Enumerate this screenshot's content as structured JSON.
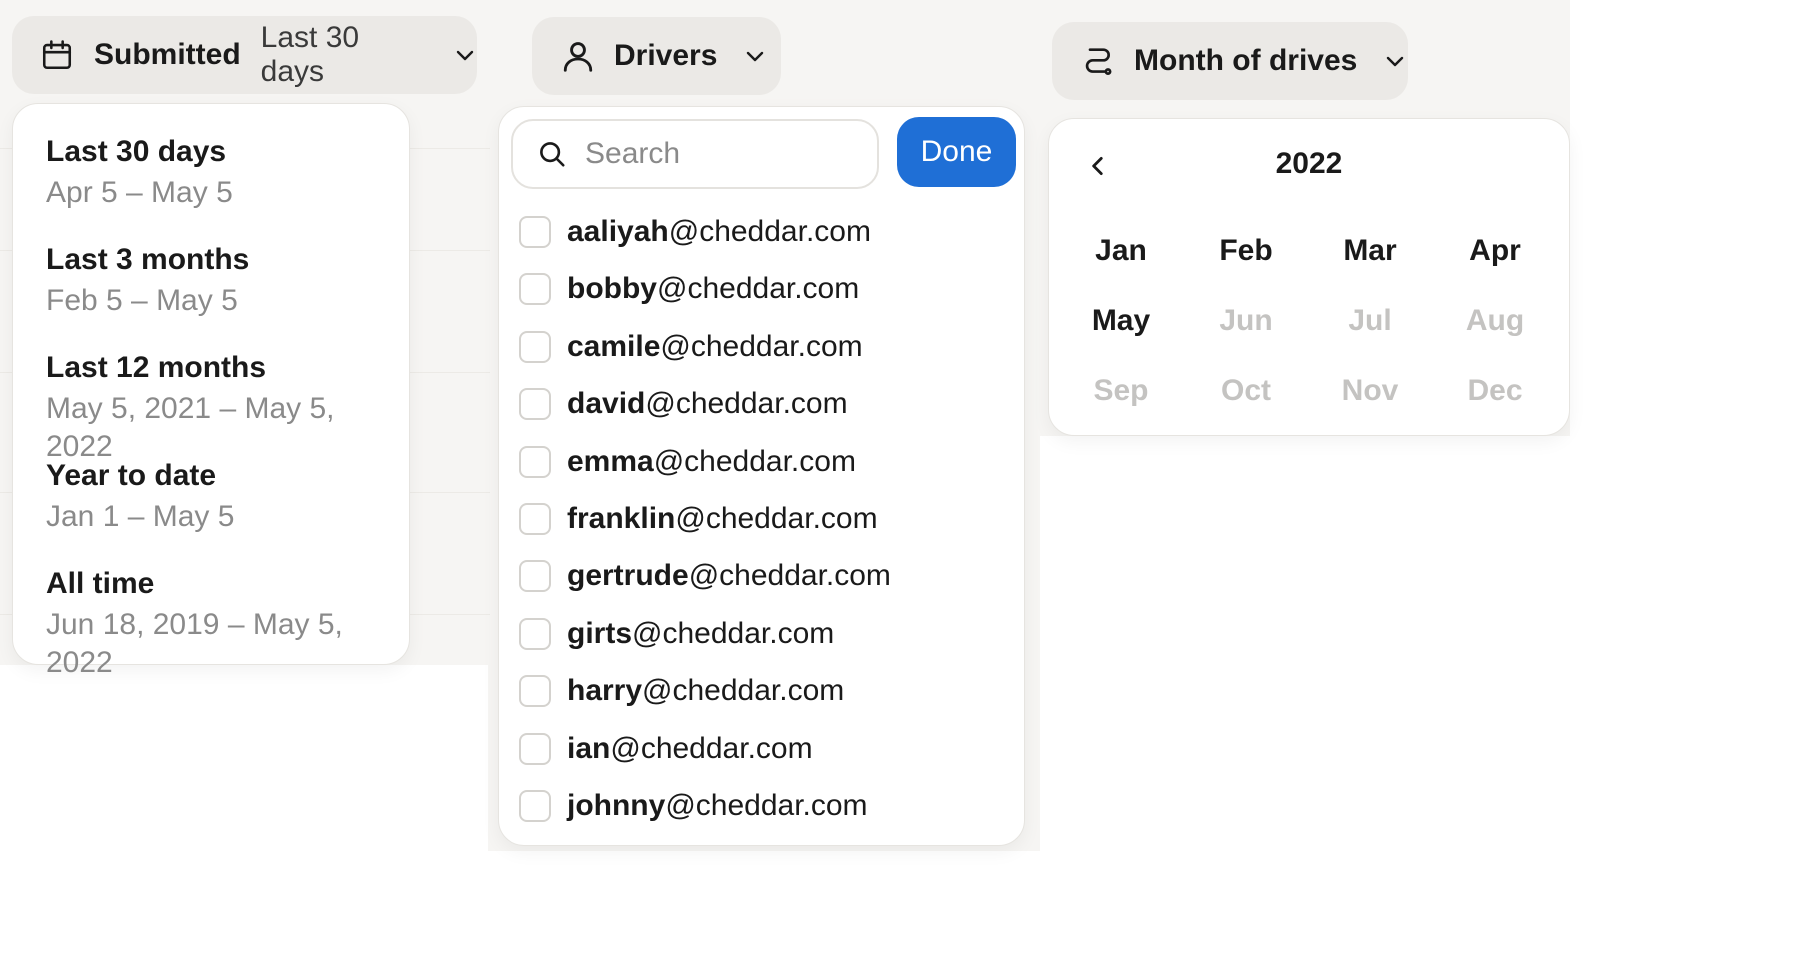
{
  "date_filter": {
    "label": "Submitted",
    "value": "Last 30 days",
    "icons": {
      "leading": "calendar-icon",
      "trailing": "chevron-down-icon"
    },
    "options": [
      {
        "title": "Last 30 days",
        "range": "Apr 5 – May 5"
      },
      {
        "title": "Last 3 months",
        "range": "Feb 5 – May 5"
      },
      {
        "title": "Last 12 months",
        "range": "May 5, 2021 – May 5, 2022"
      },
      {
        "title": "Year to date",
        "range": "Jan 1 – May 5"
      },
      {
        "title": "All time",
        "range": "Jun 18, 2019 – May 5, 2022"
      }
    ]
  },
  "drivers_filter": {
    "label": "Drivers",
    "icons": {
      "leading": "user-icon",
      "trailing": "chevron-down-icon"
    },
    "search_placeholder": "Search",
    "done_label": "Done",
    "accent_color": "#1f6fd6",
    "drivers": [
      {
        "name": "aaliyah",
        "domain": "@cheddar.com"
      },
      {
        "name": "bobby",
        "domain": "@cheddar.com"
      },
      {
        "name": "camile",
        "domain": "@cheddar.com"
      },
      {
        "name": "david",
        "domain": "@cheddar.com"
      },
      {
        "name": "emma",
        "domain": "@cheddar.com"
      },
      {
        "name": "franklin",
        "domain": "@cheddar.com"
      },
      {
        "name": "gertrude",
        "domain": "@cheddar.com"
      },
      {
        "name": "girts",
        "domain": "@cheddar.com"
      },
      {
        "name": "harry",
        "domain": "@cheddar.com"
      },
      {
        "name": "ian",
        "domain": "@cheddar.com"
      },
      {
        "name": "johnny",
        "domain": "@cheddar.com"
      }
    ]
  },
  "month_filter": {
    "label": "Month of drives",
    "icons": {
      "leading": "route-icon",
      "trailing": "chevron-down-icon",
      "prev": "chevron-left-icon"
    },
    "year": "2022",
    "months": [
      {
        "label": "Jan",
        "enabled": true
      },
      {
        "label": "Feb",
        "enabled": true
      },
      {
        "label": "Mar",
        "enabled": true
      },
      {
        "label": "Apr",
        "enabled": true
      },
      {
        "label": "May",
        "enabled": true
      },
      {
        "label": "Jun",
        "enabled": false
      },
      {
        "label": "Jul",
        "enabled": false
      },
      {
        "label": "Aug",
        "enabled": false
      },
      {
        "label": "Sep",
        "enabled": false
      },
      {
        "label": "Oct",
        "enabled": false
      },
      {
        "label": "Nov",
        "enabled": false
      },
      {
        "label": "Dec",
        "enabled": false
      }
    ]
  }
}
